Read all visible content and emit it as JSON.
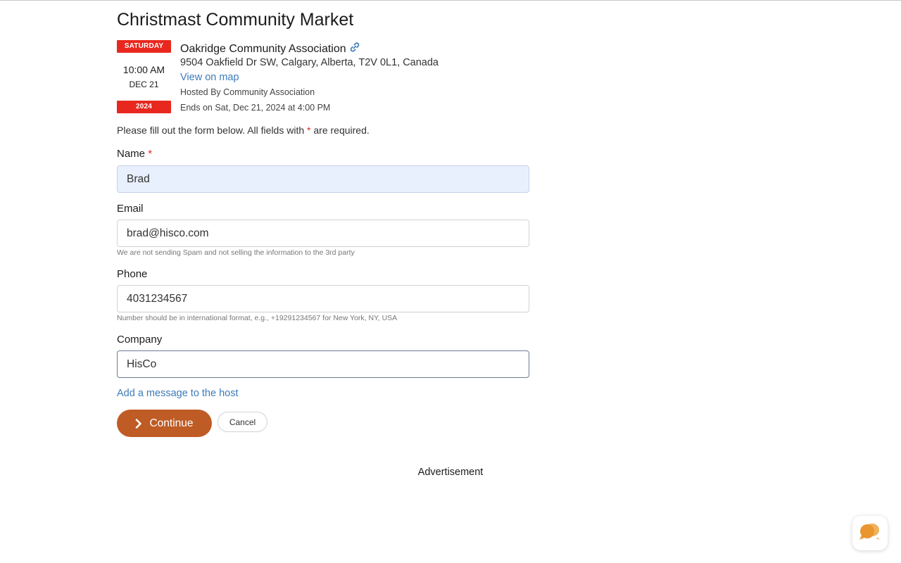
{
  "event": {
    "title": "Christmast Community Market",
    "calendar": {
      "weekday": "SATURDAY",
      "time": "10:00 AM",
      "date": "DEC 21",
      "year": "2024"
    },
    "venue": {
      "name": "Oakridge Community Association",
      "address": "9504 Oakfield Dr SW, Calgary, Alberta, T2V 0L1, Canada",
      "map_link": "View on map",
      "hosted_by": "Hosted By  Community Association",
      "ends_on": "Ends on  Sat, Dec 21, 2024 at 4:00 PM"
    }
  },
  "form": {
    "intro_before": "Please fill out the form below. All fields with ",
    "intro_star": "*",
    "intro_after": " are required.",
    "required_star": "*",
    "fields": {
      "name": {
        "label": "Name",
        "value": "Brad"
      },
      "email": {
        "label": "Email",
        "value": "brad@hisco.com",
        "hint": "We are not sending Spam and not selling the information to the 3rd party"
      },
      "phone": {
        "label": "Phone",
        "value": "4031234567",
        "hint": "Number should be in international format, e.g., +19291234567 for New York, NY, USA"
      },
      "company": {
        "label": "Company",
        "value": "HisCo"
      }
    },
    "add_message_link": "Add a message to the host",
    "continue_label": "Continue",
    "cancel_label": "Cancel"
  },
  "advertisement_label": "Advertisement",
  "icons": {
    "link": "link-icon",
    "continue": "chevron-right-icon",
    "chat": "chat-bubbles-icon"
  },
  "colors": {
    "badge_red": "#e8281e",
    "link_blue": "#3c7bb9",
    "continue_button": "#bf5b24",
    "chat_icon": "#e9962f",
    "autofill_bg": "#e8f0fe"
  }
}
